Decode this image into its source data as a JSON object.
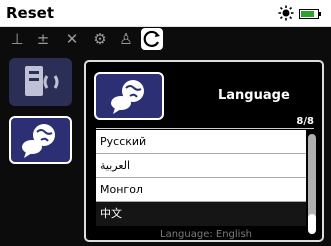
{
  "window": {
    "title": "Reset"
  },
  "status": {
    "sun_icon": "sun-icon",
    "battery_icon": "battery-icon",
    "battery_level": 0.8
  },
  "toolbar": {
    "icons": [
      "level-icon",
      "levels-icon",
      "wrench-screwdriver-icon",
      "gear-icon",
      "user-icon",
      "refresh-icon"
    ],
    "selected_index": 5
  },
  "dialog": {
    "title": "Language",
    "count": "8/8",
    "items": [
      "Русский",
      "العربية",
      "Монгол",
      "中文"
    ],
    "selected_item": "中文",
    "footer_text": "Language: English"
  },
  "colors": {
    "tile_dark_blue": "#2c2f74",
    "tile_dim": "#2b2f56",
    "battery_green": "#2aa52a"
  }
}
